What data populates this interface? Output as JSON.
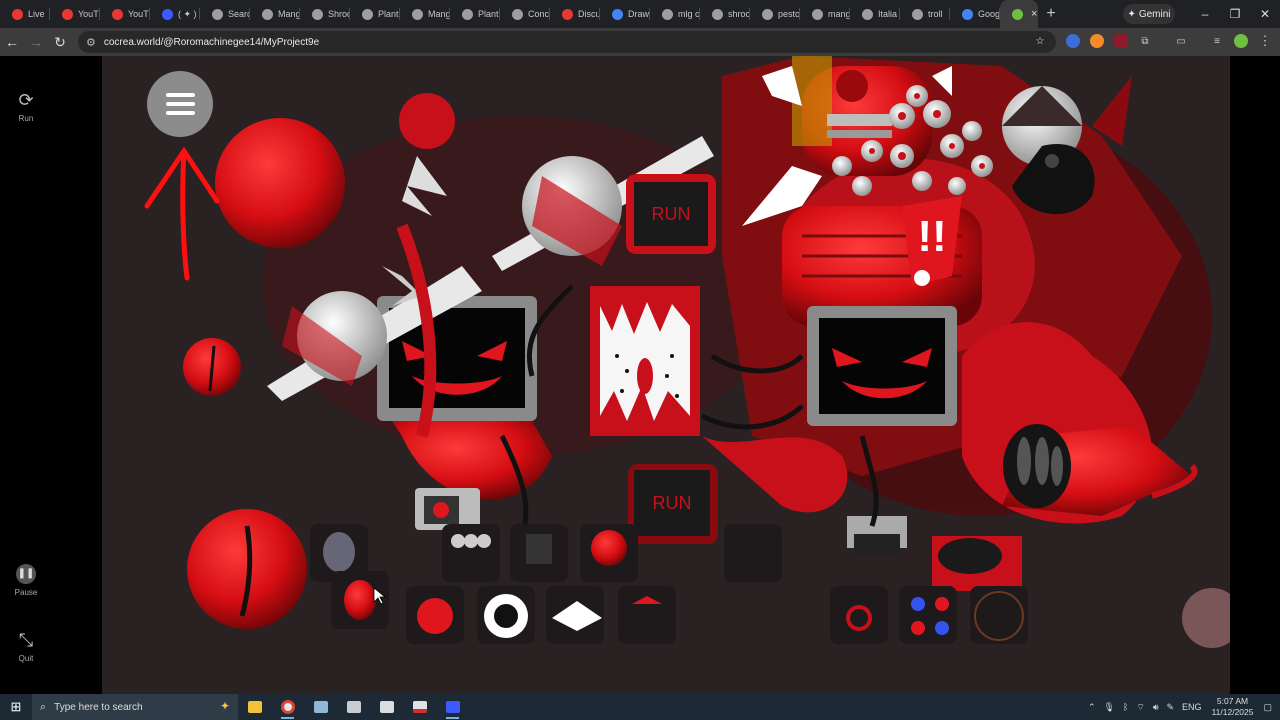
{
  "browser": {
    "tabs": [
      {
        "label": "Live",
        "color": "#e53935"
      },
      {
        "label": "YouT",
        "color": "#e53935"
      },
      {
        "label": "YouT",
        "color": "#e53935"
      },
      {
        "label": "( ✦ )",
        "color": "#3d5afe"
      },
      {
        "label": "Searc",
        "color": "#9e9e9e"
      },
      {
        "label": "Mang",
        "color": "#9e9e9e"
      },
      {
        "label": "Shroo",
        "color": "#9e9e9e"
      },
      {
        "label": "Plant",
        "color": "#9e9e9e"
      },
      {
        "label": "Mang",
        "color": "#9e9e9e"
      },
      {
        "label": "Plant",
        "color": "#9e9e9e"
      },
      {
        "label": "Conc",
        "color": "#9e9e9e"
      },
      {
        "label": "Discu",
        "color": "#e53935"
      },
      {
        "label": "Draw",
        "color": "#4285f4"
      },
      {
        "label": "mlg c",
        "color": "#9e9e9e"
      },
      {
        "label": "shroo",
        "color": "#9e9e9e"
      },
      {
        "label": "pesto",
        "color": "#9e9e9e"
      },
      {
        "label": "mang",
        "color": "#9e9e9e"
      },
      {
        "label": "Italia",
        "color": "#9e9e9e"
      },
      {
        "label": "troll",
        "color": "#9e9e9e"
      },
      {
        "label": "Goog",
        "color": "#4285f4"
      }
    ],
    "active_tab_icon": "cocrea-icon",
    "active_tab_close": "×",
    "new_tab": "+",
    "gemini_label": "Gemini",
    "url": "cocrea.world/@Roromachinegee14/MyProject9e",
    "window_controls": {
      "minimize": "–",
      "restore": "❐",
      "close": "✕"
    }
  },
  "sidebar": {
    "run_label": "Run",
    "pause_label": "Pause",
    "quit_label": "Quit"
  },
  "stage": {
    "run_button_top": "RUN",
    "run_button_bottom": "RUN",
    "alert": "!!"
  },
  "taskbar": {
    "search_placeholder": "Type here to search",
    "language": "ENG",
    "time": "5:07 AM",
    "date": "11/12/2025"
  },
  "colors": {
    "stage_bg": "#2a2123",
    "accent_red": "#d30d12",
    "dark_red": "#7a0a0c",
    "monitor_grey": "#8a8a8a"
  }
}
